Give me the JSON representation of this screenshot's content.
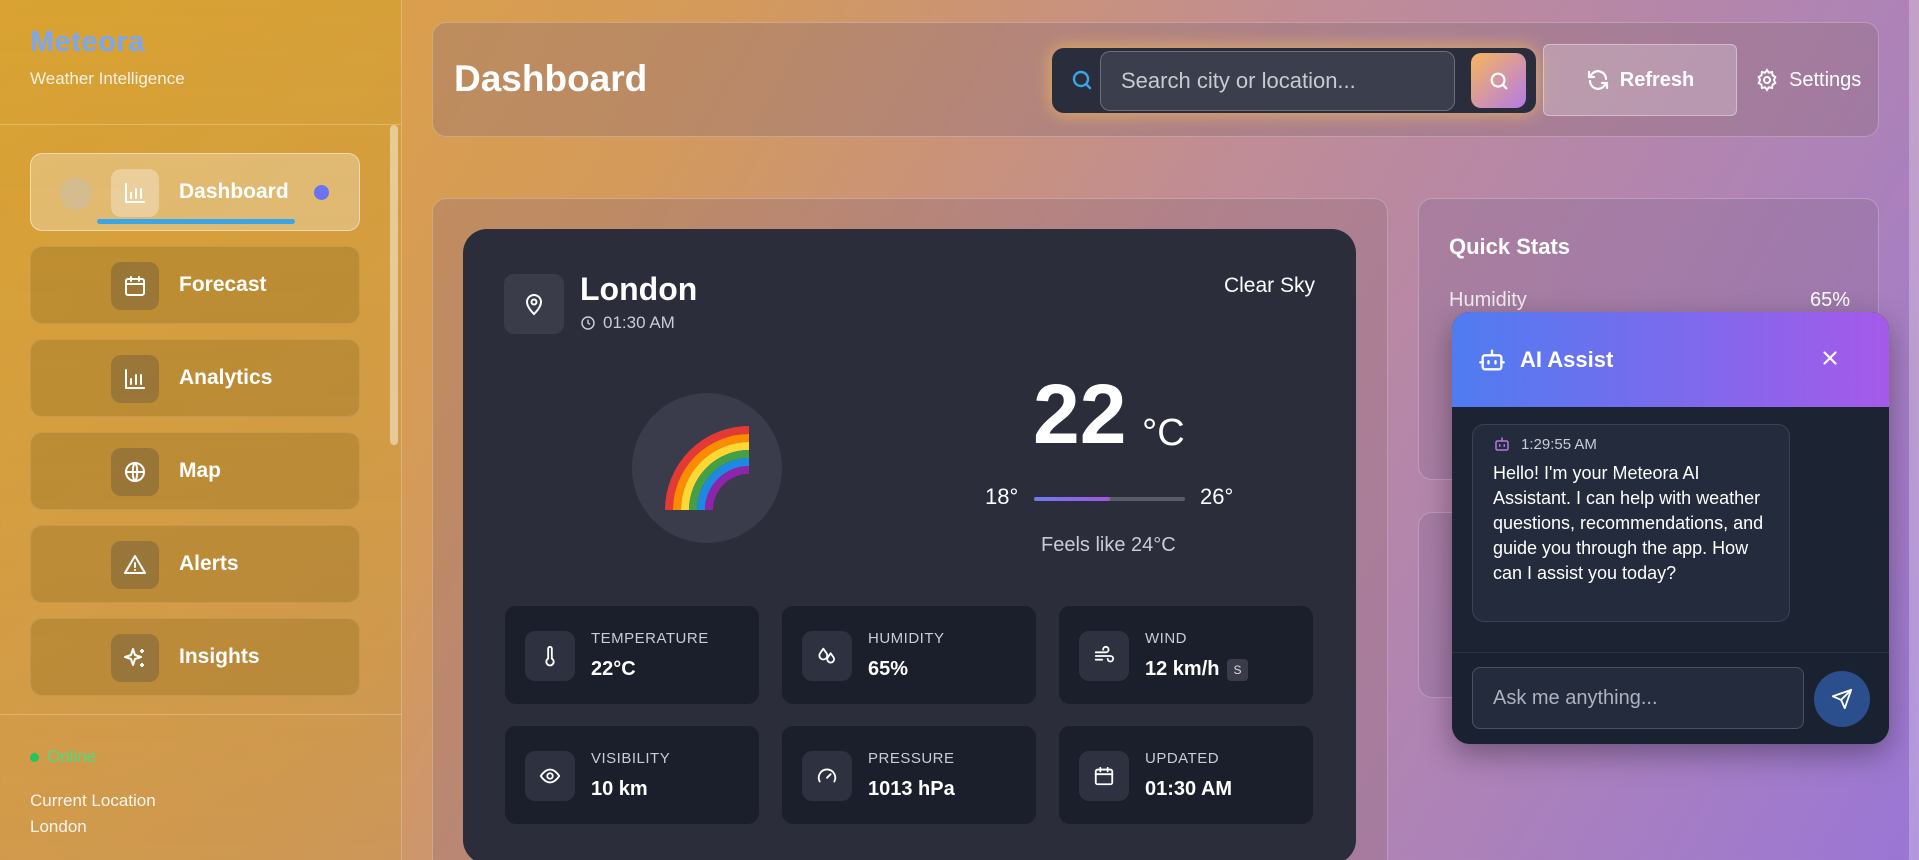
{
  "brand": {
    "name": "Meteora",
    "subtitle": "Weather Intelligence"
  },
  "sidebar": {
    "items": [
      {
        "label": "Dashboard",
        "icon": "bar-chart-icon",
        "active": true
      },
      {
        "label": "Forecast",
        "icon": "calendar-icon"
      },
      {
        "label": "Analytics",
        "icon": "bar-chart-icon"
      },
      {
        "label": "Map",
        "icon": "globe-icon"
      },
      {
        "label": "Alerts",
        "icon": "warning-icon"
      },
      {
        "label": "Insights",
        "icon": "sparkles-icon"
      }
    ],
    "status": "Online",
    "location_label": "Current Location",
    "location_value": "London"
  },
  "header": {
    "title": "Dashboard",
    "search_placeholder": "Search city or location...",
    "refresh_label": "Refresh",
    "settings_label": "Settings"
  },
  "weather": {
    "city": "London",
    "time": "01:30 AM",
    "condition": "Clear Sky",
    "icon": "🌈",
    "temperature": "22",
    "unit": "°C",
    "low": "18°",
    "high": "26°",
    "range_fill_fraction": 0.5,
    "feels_like": "Feels like 24°C",
    "stats": [
      {
        "label": "TEMPERATURE",
        "value": "22°C",
        "icon": "thermometer-icon"
      },
      {
        "label": "HUMIDITY",
        "value": "65%",
        "icon": "droplets-icon"
      },
      {
        "label": "WIND",
        "value": "12 km/h",
        "badge": "S",
        "icon": "wind-icon"
      },
      {
        "label": "VISIBILITY",
        "value": "10 km",
        "icon": "eye-icon"
      },
      {
        "label": "PRESSURE",
        "value": "1013 hPa",
        "icon": "gauge-icon"
      },
      {
        "label": "UPDATED",
        "value": "01:30 AM",
        "icon": "calendar-icon"
      }
    ]
  },
  "quick_stats": {
    "title": "Quick Stats",
    "rows": [
      {
        "label": "Humidity",
        "value": "65%"
      }
    ]
  },
  "ai": {
    "title": "AI Assist",
    "message_time": "1:29:55 AM",
    "message": "Hello! I'm your Meteora AI Assistant. I can help with weather questions, recommendations, and guide you through the app. How can I assist you today?",
    "input_placeholder": "Ask me anything..."
  },
  "colors": {
    "accent": "#6b74f0",
    "brand": "#7aa7f0",
    "online": "#22c55e",
    "card": "#2b2d3b"
  }
}
